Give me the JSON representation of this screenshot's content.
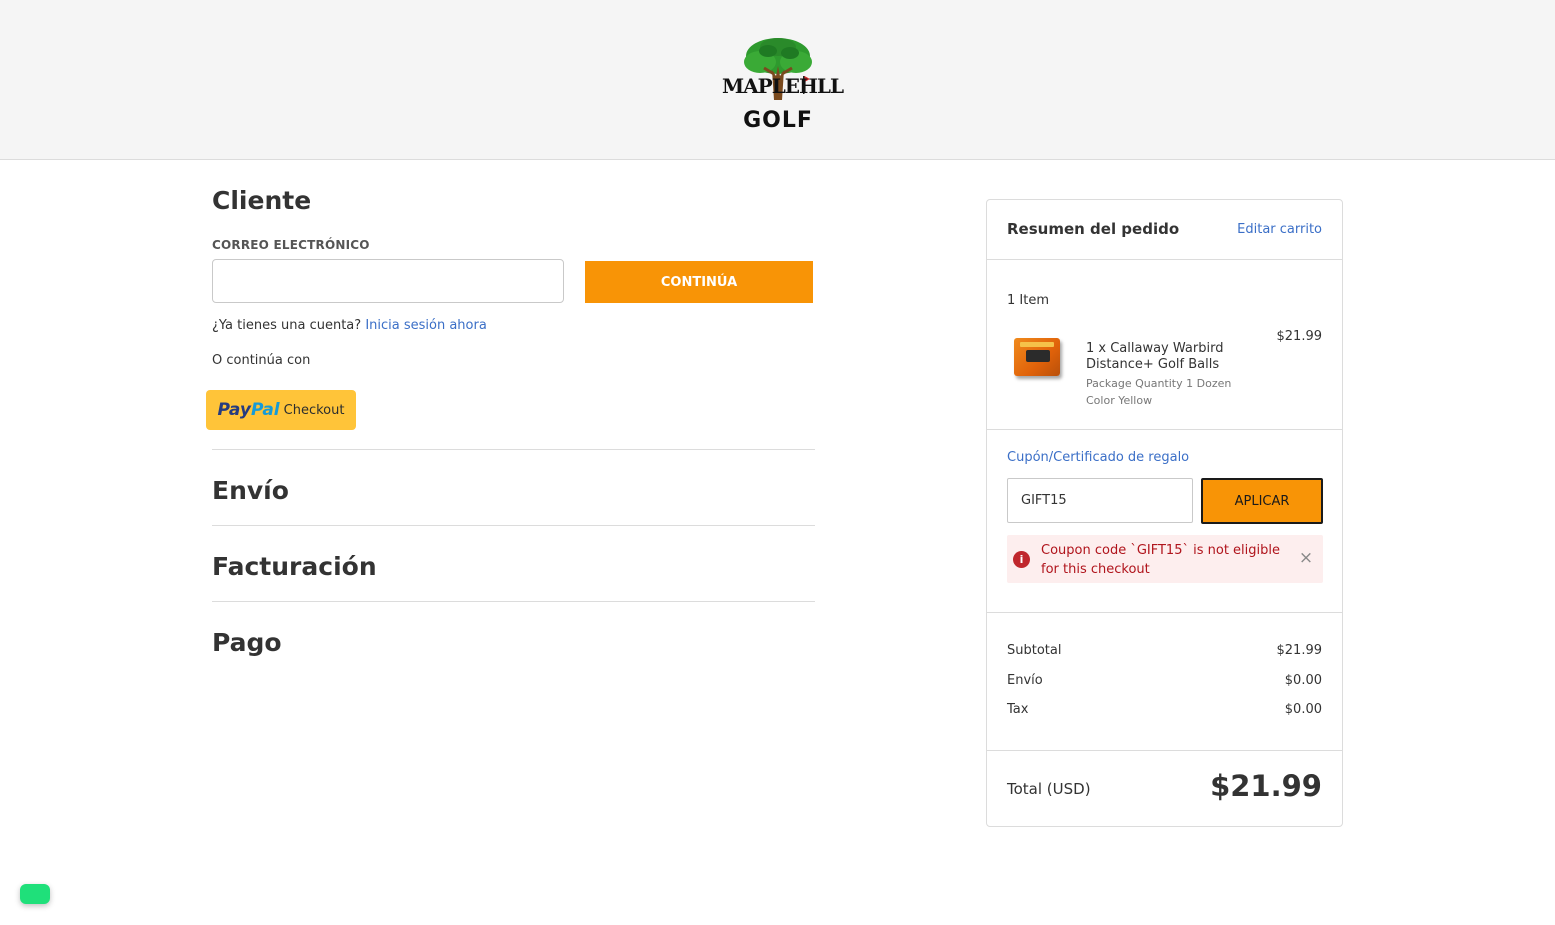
{
  "brand": {
    "logo_line1": [
      "MAPLE",
      "H",
      "LL"
    ],
    "logo_line2": "GOLF"
  },
  "customer": {
    "title": "Cliente",
    "email_label": "CORREO ELECTRÓNICO",
    "email_value": "",
    "continue_label": "CONTINÚA",
    "account_prompt": "¿Ya tienes una cuenta?",
    "signin_link": "Inicia sesión ahora",
    "or_continue": "O continúa con",
    "paypal_pay": "Pay",
    "paypal_pal": "Pal",
    "paypal_checkout": "Checkout"
  },
  "steps": {
    "shipping": "Envío",
    "billing": "Facturación",
    "payment": "Pago"
  },
  "summary": {
    "title": "Resumen del pedido",
    "edit_cart": "Editar carrito",
    "items_count": "1 Item",
    "product": {
      "name": "1 x Callaway Warbird Distance+ Golf Balls",
      "price": "$21.99",
      "option1": "Package Quantity 1 Dozen",
      "option2": "Color Yellow"
    },
    "coupon": {
      "link": "Cupón/Certificado de regalo",
      "value": "GIFT15",
      "apply_label": "APLICAR",
      "error": "Coupon code `GIFT15` is not eligible for this checkout",
      "error_icon": "i",
      "close_icon": "×"
    },
    "totals": [
      {
        "label": "Subtotal",
        "value": "$21.99"
      },
      {
        "label": "Envío",
        "value": "$0.00"
      },
      {
        "label": "Tax",
        "value": "$0.00"
      }
    ],
    "grand_total_label": "Total (USD)",
    "grand_total_value": "$21.99"
  },
  "colors": {
    "accent": "#f89406",
    "link": "#3b6fc7",
    "error": "#b0141c",
    "paypal": "#ffc439",
    "chat_widget": "#1fe07a"
  }
}
